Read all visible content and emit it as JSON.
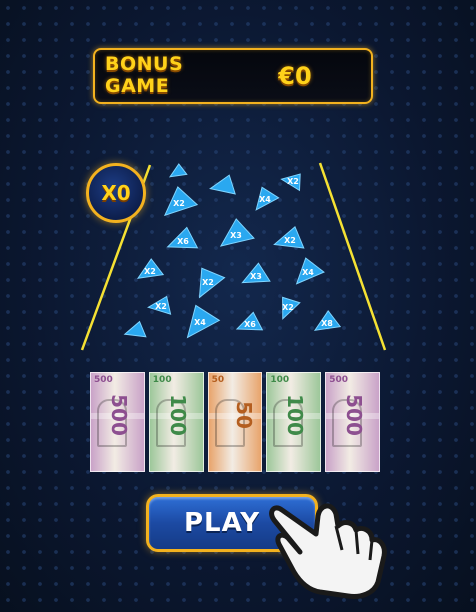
{
  "header": {
    "title_line1": "BONUS",
    "title_line2": "GAME",
    "amount": "€0"
  },
  "multiplier_badge": "X0",
  "shards": [
    {
      "label": ""
    },
    {
      "label": "X2"
    },
    {
      "label": ""
    },
    {
      "label": "X2"
    },
    {
      "label": "X4"
    },
    {
      "label": "X6"
    },
    {
      "label": "X3"
    },
    {
      "label": "X2"
    },
    {
      "label": "X2"
    },
    {
      "label": "X2"
    },
    {
      "label": "X3"
    },
    {
      "label": "X4"
    },
    {
      "label": "X2"
    },
    {
      "label": "X4"
    },
    {
      "label": "X6"
    },
    {
      "label": "X2"
    },
    {
      "label": "X8"
    },
    {
      "label": ""
    }
  ],
  "banknotes": [
    {
      "value": "500",
      "color": "#c9a2c8",
      "accent": "#8d4f90"
    },
    {
      "value": "100",
      "color": "#9dc79a",
      "accent": "#3f8a49"
    },
    {
      "value": "50",
      "color": "#e8a46c",
      "accent": "#b45e1f"
    },
    {
      "value": "100",
      "color": "#9dc79a",
      "accent": "#3f8a49"
    },
    {
      "value": "500",
      "color": "#c9a2c8",
      "accent": "#8d4f90"
    }
  ],
  "play_button": {
    "label": "PLAY"
  },
  "icons": {
    "hand": "pointing-hand-icon"
  },
  "colors": {
    "gold": "#f3b21f",
    "shard": "#2aa8f0",
    "rail": "#f5e133"
  }
}
